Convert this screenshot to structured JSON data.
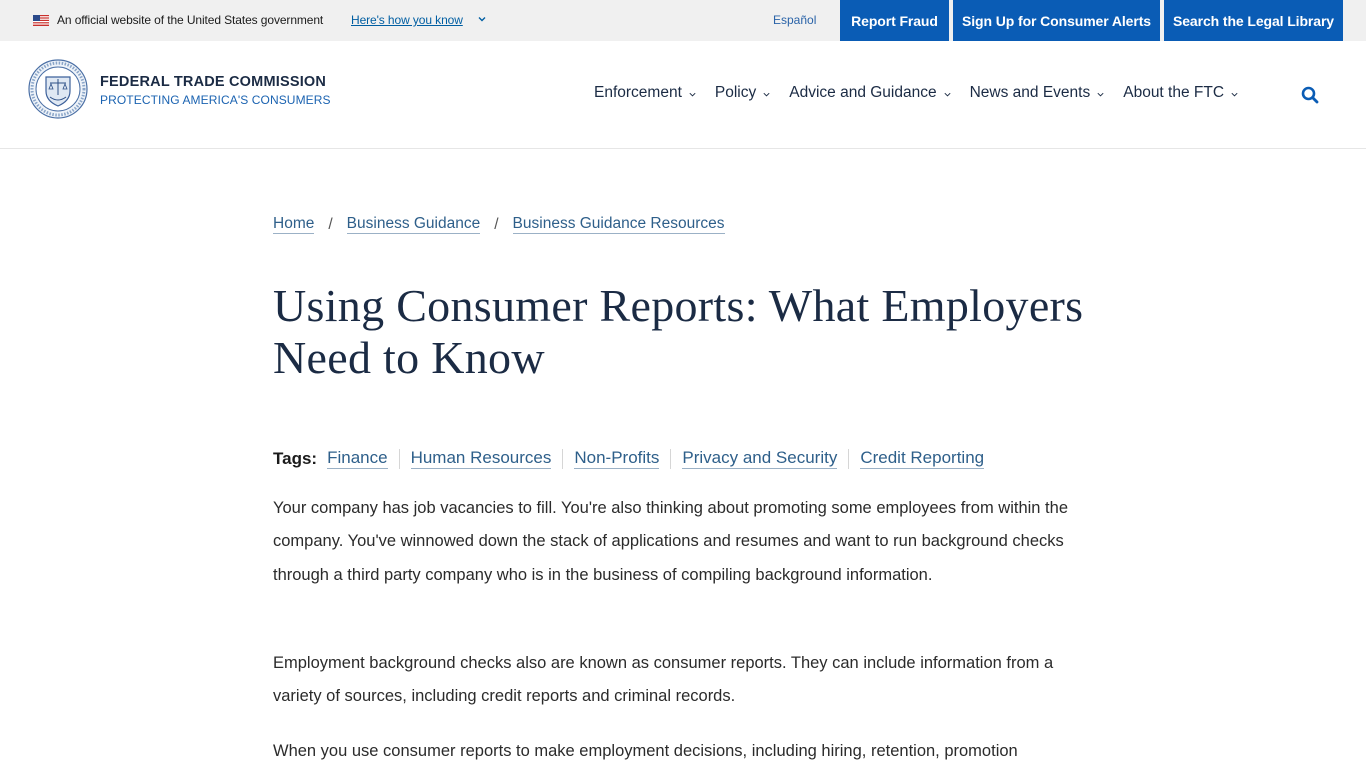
{
  "gov_banner": {
    "text": "An official website of the United States government",
    "link": "Here's how you know",
    "flag_icon": "us-flag-icon"
  },
  "utility_nav": {
    "espanol": "Español",
    "buttons": [
      {
        "label": "Report Fraud"
      },
      {
        "label": "Sign Up for Consumer Alerts"
      },
      {
        "label": "Search the Legal Library"
      }
    ],
    "button_color": "#0a5cb5"
  },
  "header": {
    "title": "FEDERAL TRADE COMMISSION",
    "subtitle": "PROTECTING AMERICA'S CONSUMERS",
    "nav": [
      {
        "label": "Enforcement"
      },
      {
        "label": "Policy"
      },
      {
        "label": "Advice and Guidance"
      },
      {
        "label": "News and Events"
      },
      {
        "label": "About the FTC"
      }
    ],
    "search_icon": "search-icon"
  },
  "breadcrumb": [
    {
      "label": "Home"
    },
    {
      "label": "Business Guidance"
    },
    {
      "label": "Business Guidance Resources"
    }
  ],
  "breadcrumb_separator": "/",
  "page": {
    "title": "Using Consumer Reports: What Employers Need to Know",
    "tags_label": "Tags:",
    "tags": [
      "Finance",
      "Human Resources",
      "Non-Profits",
      "Privacy and Security",
      "Credit Reporting"
    ],
    "paragraphs": [
      "Your company has job vacancies to fill. You're also thinking about promoting some employees from within the company. You've winnowed down the stack of applications and resumes and want to run background checks through a third party company who is in the business of compiling background information.",
      "Employment background checks also are known as consumer reports. They can include information from a variety of sources, including credit reports and criminal records.",
      "When you use consumer reports to make employment decisions, including hiring, retention, promotion"
    ]
  }
}
